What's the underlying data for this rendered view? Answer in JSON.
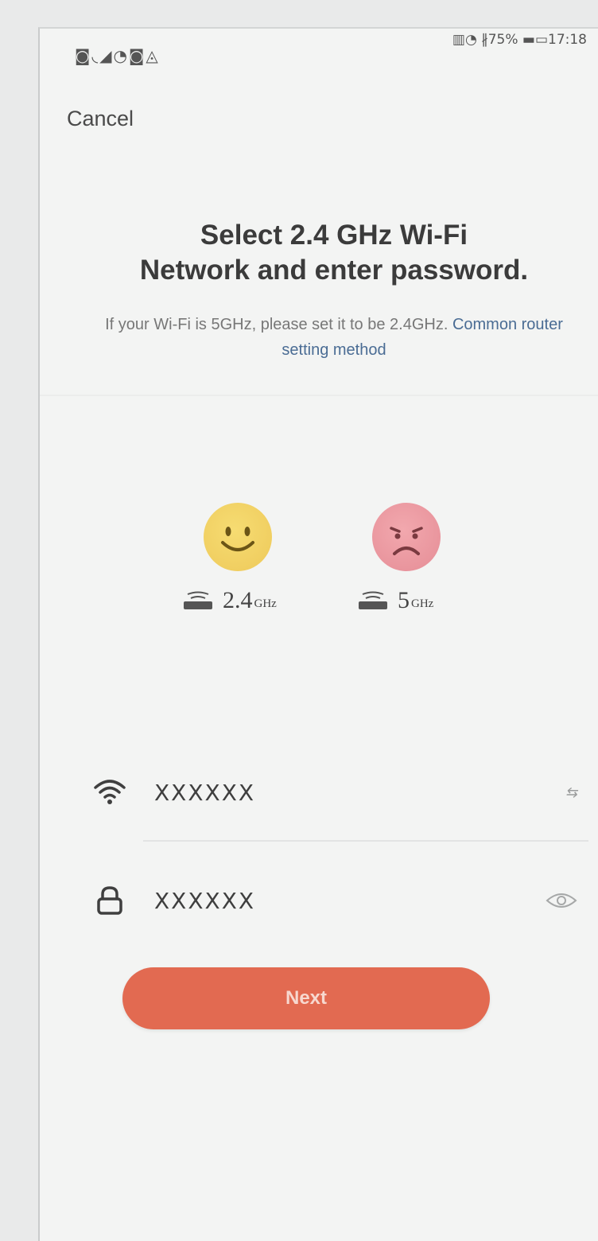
{
  "status_bar": {
    "left_icons": "◙◟◢◔◙◬",
    "right_text": "▥◔ ∦75% ▬▭17:18"
  },
  "header": {
    "cancel_label": "Cancel"
  },
  "main": {
    "title_line1": "Select 2.4 GHz Wi-Fi",
    "title_line2": "Network and enter password.",
    "subtitle_text": "If your Wi-Fi is 5GHz, please set it to be 2.4GHz.",
    "subtitle_link": "Common router setting method"
  },
  "bands": [
    {
      "label": "2.4",
      "unit": "GHz",
      "status": "supported",
      "icon": "happy-face-icon",
      "color": "#eec95a"
    },
    {
      "label": "5",
      "unit": "GHz",
      "status": "unsupported",
      "icon": "sad-face-icon",
      "color": "#e58d96"
    }
  ],
  "form": {
    "wifi_name": "XXXXXX",
    "wifi_switch_label": "⇆",
    "password": "XXXXXX",
    "wifi_icon": "wifi-icon",
    "lock_icon": "lock-icon",
    "eye_icon": "eye-icon"
  },
  "actions": {
    "next_label": "Next",
    "next_color": "#e26a51"
  }
}
